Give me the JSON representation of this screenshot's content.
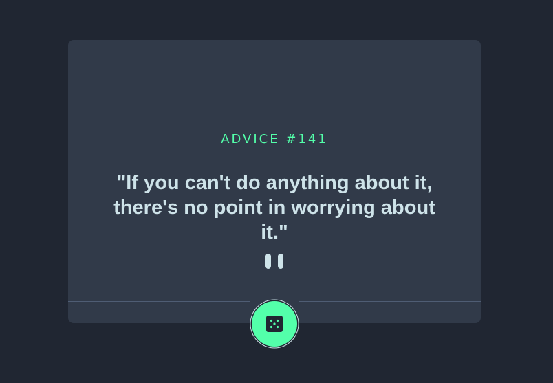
{
  "advice": {
    "id_label": "ADVICE #141",
    "quote": "\"If you can't do anything about it, there's no point in worrying about it.\""
  },
  "icons": {
    "divider": "pause-icon",
    "button": "dice-icon"
  },
  "colors": {
    "background": "#202632",
    "card": "#313A49",
    "accent": "#53FFAA",
    "text": "#CEE3E9",
    "divider": "#4F5D74"
  }
}
